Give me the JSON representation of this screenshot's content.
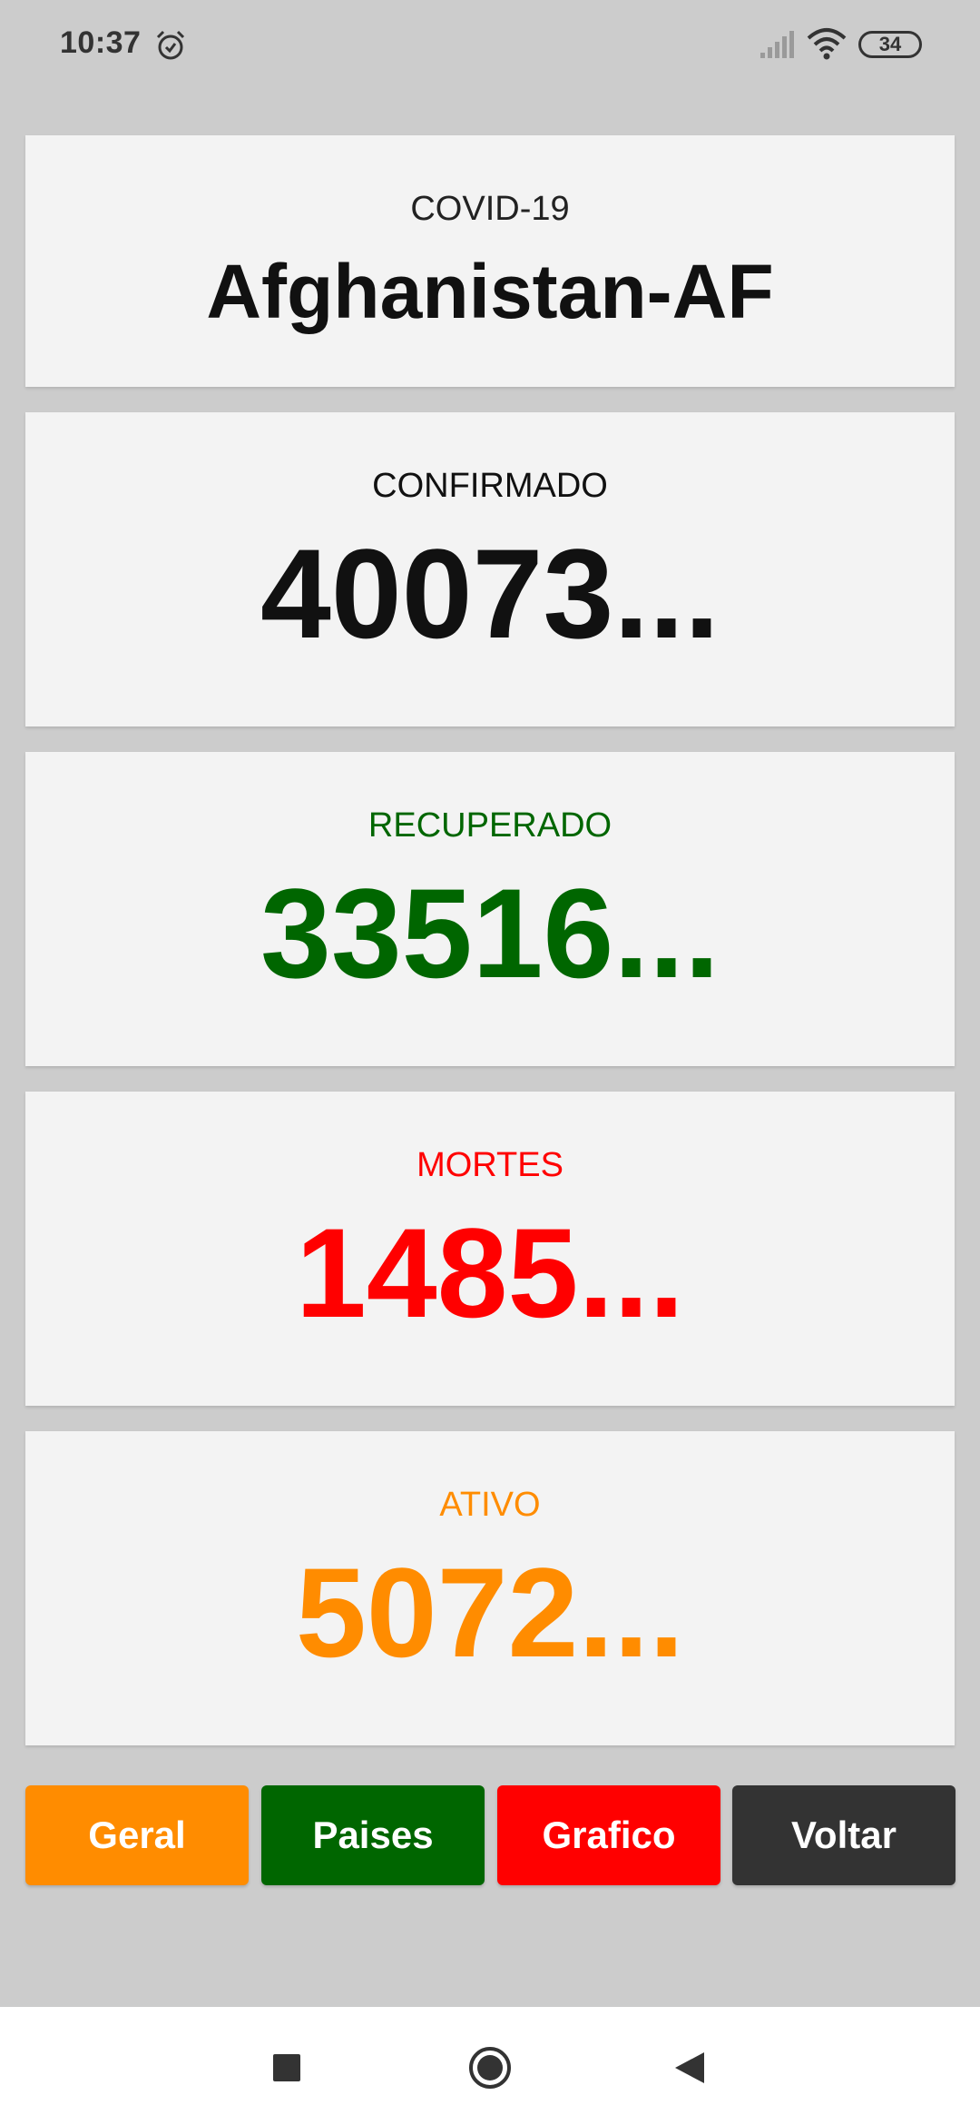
{
  "status_bar": {
    "time": "10:37",
    "battery": "34"
  },
  "header_card": {
    "subtitle": "COVID-19",
    "country": "Afghanistan-AF"
  },
  "stats": {
    "confirmed": {
      "label": "CONFIRMADO",
      "value": "40073...",
      "color": "#111111"
    },
    "recovered": {
      "label": "RECUPERADO",
      "value": "33516...",
      "color": "#006600"
    },
    "deaths": {
      "label": "MORTES",
      "value": "1485...",
      "color": "#ff0000"
    },
    "active": {
      "label": "ATIVO",
      "value": "5072...",
      "color": "#ff8c00"
    }
  },
  "buttons": {
    "geral": {
      "label": "Geral",
      "color": "#ff8c00"
    },
    "paises": {
      "label": "Paises",
      "color": "#006600"
    },
    "grafico": {
      "label": "Grafico",
      "color": "#ff0000"
    },
    "voltar": {
      "label": "Voltar",
      "color": "#333333"
    }
  },
  "icons": {
    "alarm": "alarm-clock-icon",
    "signal": "cell-signal-icon",
    "wifi": "wifi-icon",
    "battery": "battery-icon",
    "recents": "recents-square-icon",
    "home": "home-circle-icon",
    "back": "back-triangle-icon"
  }
}
